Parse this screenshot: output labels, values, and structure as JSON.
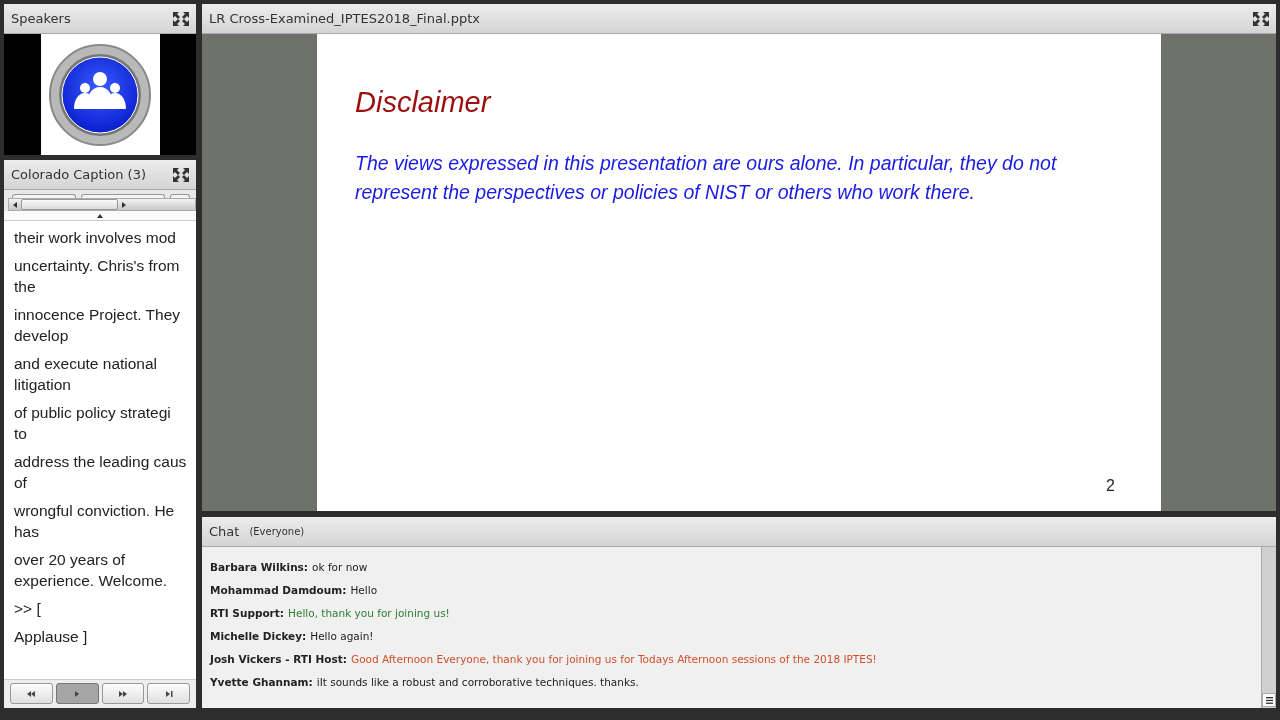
{
  "speakers_pod": {
    "title": "Speakers"
  },
  "caption_pod": {
    "title": "Colorado Caption (3)",
    "captions": [
      {
        "lines": [
          "their work involves mod"
        ]
      },
      {
        "lines": [
          "uncertainty. Chris's from",
          "the"
        ]
      },
      {
        "lines": [
          "innocence Project. They",
          "develop"
        ]
      },
      {
        "lines": [
          "and execute national",
          "litigation"
        ]
      },
      {
        "lines": [
          "of public policy strategi",
          "to"
        ]
      },
      {
        "lines": [
          "address the leading caus",
          "of"
        ]
      },
      {
        "lines": [
          "wrongful conviction. He",
          "has"
        ]
      },
      {
        "lines": [
          "over 20 years of",
          "experience. Welcome."
        ]
      },
      {
        "lines": [
          ">> ["
        ]
      },
      {
        "lines": [
          "Applause ]"
        ]
      }
    ],
    "controls": [
      {
        "kind": "rewind",
        "selected": false
      },
      {
        "kind": "play",
        "selected": true
      },
      {
        "kind": "forward",
        "selected": false
      },
      {
        "kind": "end",
        "selected": false
      }
    ]
  },
  "share_pod": {
    "title": "LR Cross-Examined_IPTES2018_Final.pptx",
    "slide": {
      "title": "Disclaimer",
      "body": "The views expressed in this presentation are ours alone.  In particular, they do not represent the perspectives or policies of NIST or others who work there.",
      "page": "2"
    }
  },
  "chat_pod": {
    "title": "Chat",
    "audience": "(Everyone)",
    "messages": [
      {
        "sender": "Barbara Wilkins:",
        "text": "ok for now",
        "color": "#222222"
      },
      {
        "sender": "Mohammad Damdoum:",
        "text": "Hello",
        "color": "#222222"
      },
      {
        "sender": "RTI Support:",
        "text": "Hello, thank you for joining us!",
        "color": "#2e7d32"
      },
      {
        "sender": "Michelle Dickey:",
        "text": "Hello again!",
        "color": "#222222"
      },
      {
        "sender": "Josh Vickers - RTI Host:",
        "text": "Good Afternoon Everyone, thank you for joining us for Todays Afternoon sessions of the 2018 IPTES!",
        "color": "#d0502a"
      },
      {
        "sender": "Yvette Ghannam:",
        "text": "iIt sounds like a robust and corroborative techniques. thanks.",
        "color": "#222222"
      }
    ]
  }
}
